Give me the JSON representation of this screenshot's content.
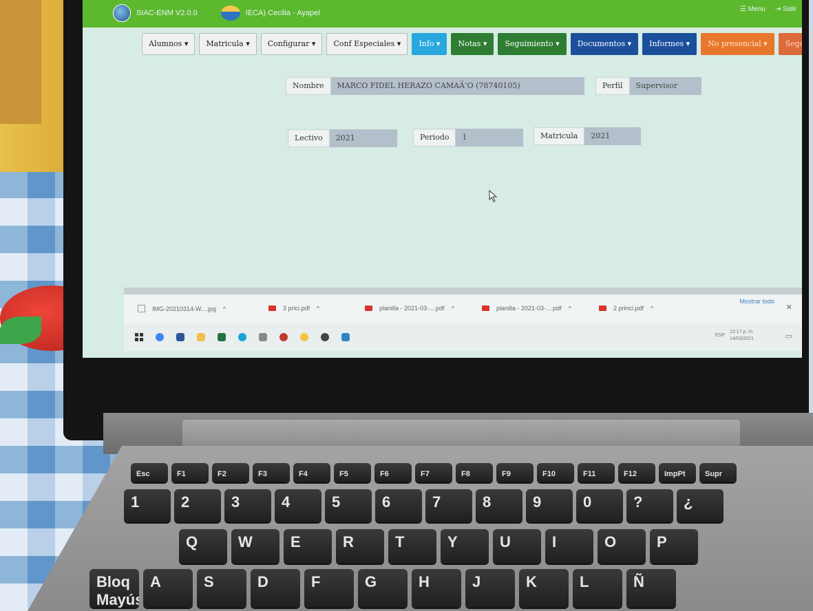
{
  "app": {
    "name": "SIAC-ENM V2.0.0",
    "school": "IECA) Cecilia - Ayapel",
    "menu_label": "Menu",
    "logout_label": "Salir"
  },
  "menu": [
    {
      "label": "Alumnos",
      "style": "default"
    },
    {
      "label": "Matricula",
      "style": "default"
    },
    {
      "label": "Configurar",
      "style": "default"
    },
    {
      "label": "Conf Especiales",
      "style": "default"
    },
    {
      "label": "Info",
      "style": "info"
    },
    {
      "label": "Notas",
      "style": "green"
    },
    {
      "label": "Seguimiento",
      "style": "green"
    },
    {
      "label": "Documentos",
      "style": "blue"
    },
    {
      "label": "Informes",
      "style": "blue"
    },
    {
      "label": "No presencial",
      "style": "orange"
    },
    {
      "label": "Seguridad",
      "style": "rust"
    }
  ],
  "user": {
    "nombre_label": "Nombre",
    "nombre_value": "MARCO FIDEL HERAZO CAMAÃ‘O (78740105)",
    "perfil_label": "Perfil",
    "perfil_value": "Supervisor"
  },
  "period": {
    "lectivo_label": "Lectivo",
    "lectivo_value": "2021",
    "periodo_label": "Periodo",
    "periodo_value": "1",
    "matricula_label": "Matricula",
    "matricula_value": "2021"
  },
  "downloads": [
    {
      "name": "IMG-20210314-W....jpg",
      "icon": "image-icon"
    },
    {
      "name": "3 prici.pdf",
      "icon": "pdf-icon"
    },
    {
      "name": "planilla - 2021-03-....pdf",
      "icon": "pdf-icon"
    },
    {
      "name": "planilla - 2021-03-....pdf",
      "icon": "pdf-icon"
    },
    {
      "name": "2 princi.pdf",
      "icon": "pdf-icon"
    }
  ],
  "downloads_show_all": "Mostrar todo",
  "taskbar": {
    "time": "12:17 p. m.",
    "date": "14/03/2021",
    "lang": "ESP"
  },
  "keyboard": {
    "fn_row": [
      "Esc",
      "F1",
      "F2",
      "F3",
      "F4",
      "F5",
      "F6",
      "F7",
      "F8",
      "F9",
      "F10",
      "F11",
      "F12",
      "ImpPt",
      "Supr"
    ],
    "num_row": [
      "1",
      "2",
      "3",
      "4",
      "5",
      "6",
      "7",
      "8",
      "9",
      "0",
      "?",
      "¿"
    ],
    "q_row": [
      "Q",
      "W",
      "E",
      "R",
      "T",
      "Y",
      "U",
      "I",
      "O",
      "P"
    ],
    "a_row": [
      "Bloq Mayús",
      "A",
      "S",
      "D",
      "F",
      "G",
      "H",
      "J",
      "K",
      "L",
      "Ñ"
    ]
  },
  "colors": {
    "topbar": "#5cb82c",
    "screen_bg": "#d6ece4"
  }
}
